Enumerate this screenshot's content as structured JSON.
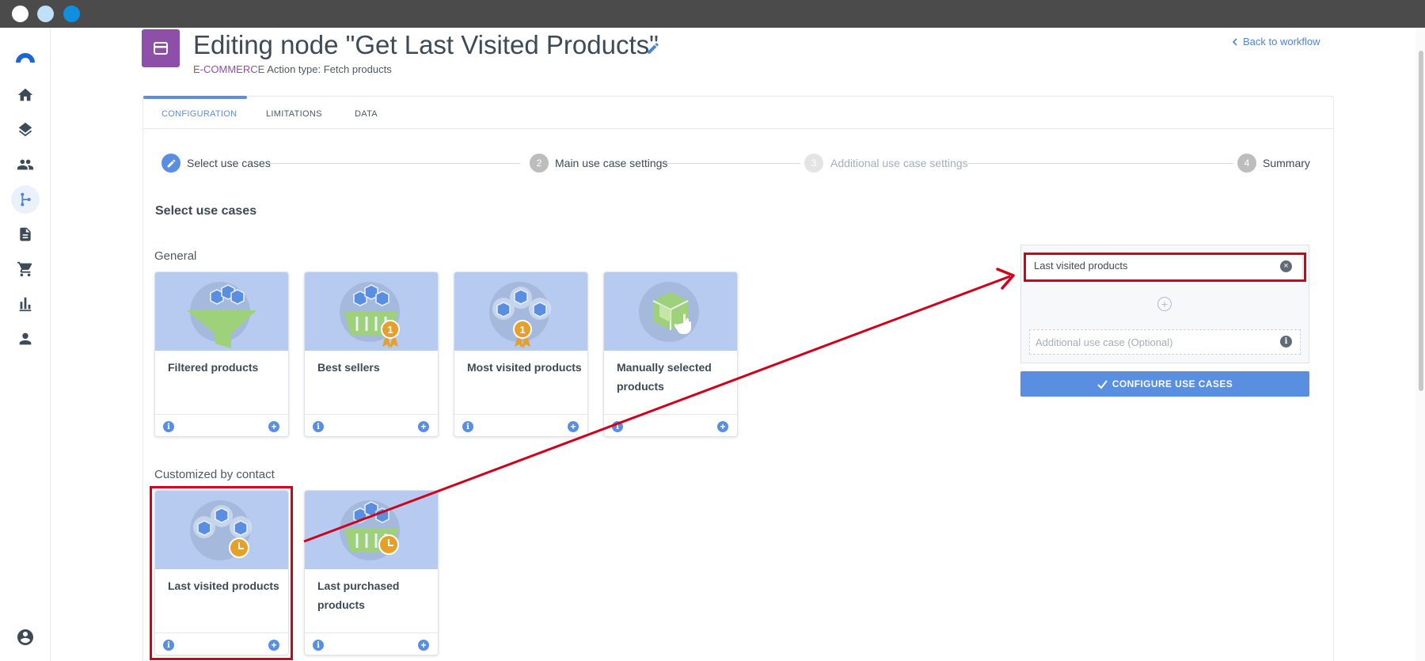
{
  "window": {
    "controls": [
      "close",
      "minimize",
      "maximize"
    ]
  },
  "sidebar": {
    "logo": "product-logo-icon",
    "items": [
      {
        "icon": "home-icon",
        "active": false
      },
      {
        "icon": "layers-icon",
        "active": false
      },
      {
        "icon": "people-icon",
        "active": false
      },
      {
        "icon": "workflow-icon",
        "active": true
      },
      {
        "icon": "document-icon",
        "active": false
      },
      {
        "icon": "cart-icon",
        "active": false
      },
      {
        "icon": "bar-chart-icon",
        "active": false
      },
      {
        "icon": "person-icon",
        "active": false
      }
    ],
    "footer_icon": "account-circle-icon"
  },
  "header": {
    "title": "Editing node \"Get Last Visited Products\"",
    "category": "E-COMMERCE",
    "action_type": "Action type: Fetch products",
    "back_link": "Back to workflow"
  },
  "tabs": [
    {
      "label": "CONFIGURATION",
      "active": true
    },
    {
      "label": "LIMITATIONS",
      "active": false
    },
    {
      "label": "DATA",
      "active": false
    }
  ],
  "stepper": [
    {
      "number": "",
      "label": "Select use cases",
      "state": "current"
    },
    {
      "number": "2",
      "label": "Main use case settings",
      "state": "pending"
    },
    {
      "number": "3",
      "label": "Additional use case settings",
      "state": "disabled"
    },
    {
      "number": "4",
      "label": "Summary",
      "state": "pending"
    }
  ],
  "section_title": "Select use cases",
  "groups": {
    "general": {
      "title": "General",
      "cards": [
        {
          "label": "Filtered products",
          "illustration": "funnel-products-icon"
        },
        {
          "label": "Best sellers",
          "illustration": "basket-medal-icon"
        },
        {
          "label": "Most visited products",
          "illustration": "boxes-medal-icon"
        },
        {
          "label": "Manually selected products",
          "illustration": "box-hand-icon"
        }
      ]
    },
    "contact": {
      "title": "Customized by contact",
      "cards": [
        {
          "label": "Last visited products",
          "illustration": "boxes-clock-icon"
        },
        {
          "label": "Last purchased products",
          "illustration": "basket-clock-icon"
        }
      ]
    }
  },
  "selection": {
    "selected": "Last visited products",
    "additional_placeholder": "Additional use case (Optional)",
    "configure_button": "CONFIGURE USE CASES"
  },
  "colors": {
    "accent": "#5a8ee0",
    "brand_purple": "#8e4fa8",
    "annotation_red": "#d0021b",
    "card_illustration_bg": "#b7cbf1",
    "medal_orange": "#e5a02a",
    "green": "#9fd07a"
  }
}
